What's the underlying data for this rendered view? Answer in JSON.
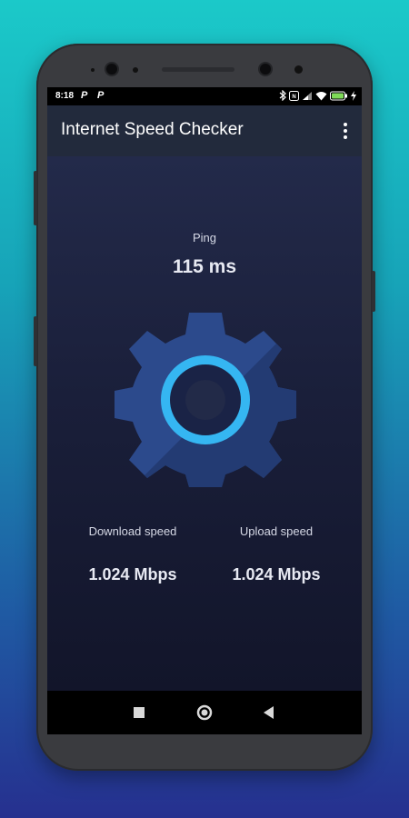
{
  "status_bar": {
    "time": "8:18",
    "notification_icons": [
      "P",
      "P"
    ],
    "system_icons": [
      "bluetooth-icon",
      "nfc-icon",
      "signal-icon",
      "wifi-icon",
      "battery-icon",
      "charging-icon"
    ]
  },
  "app_bar": {
    "title": "Internet Speed Checker",
    "menu_icon": "more-vert-icon"
  },
  "ping": {
    "label": "Ping",
    "value": "115 ms"
  },
  "center_graphic": {
    "icon": "gear-icon",
    "ring_color": "#35b6f2",
    "gear_color": "#2c4a8c"
  },
  "download": {
    "label": "Download speed",
    "value": "1.024 Mbps"
  },
  "upload": {
    "label": "Upload speed",
    "value": "1.024 Mbps"
  },
  "nav_bar": {
    "buttons": [
      "recents-icon",
      "home-icon",
      "back-icon"
    ]
  }
}
